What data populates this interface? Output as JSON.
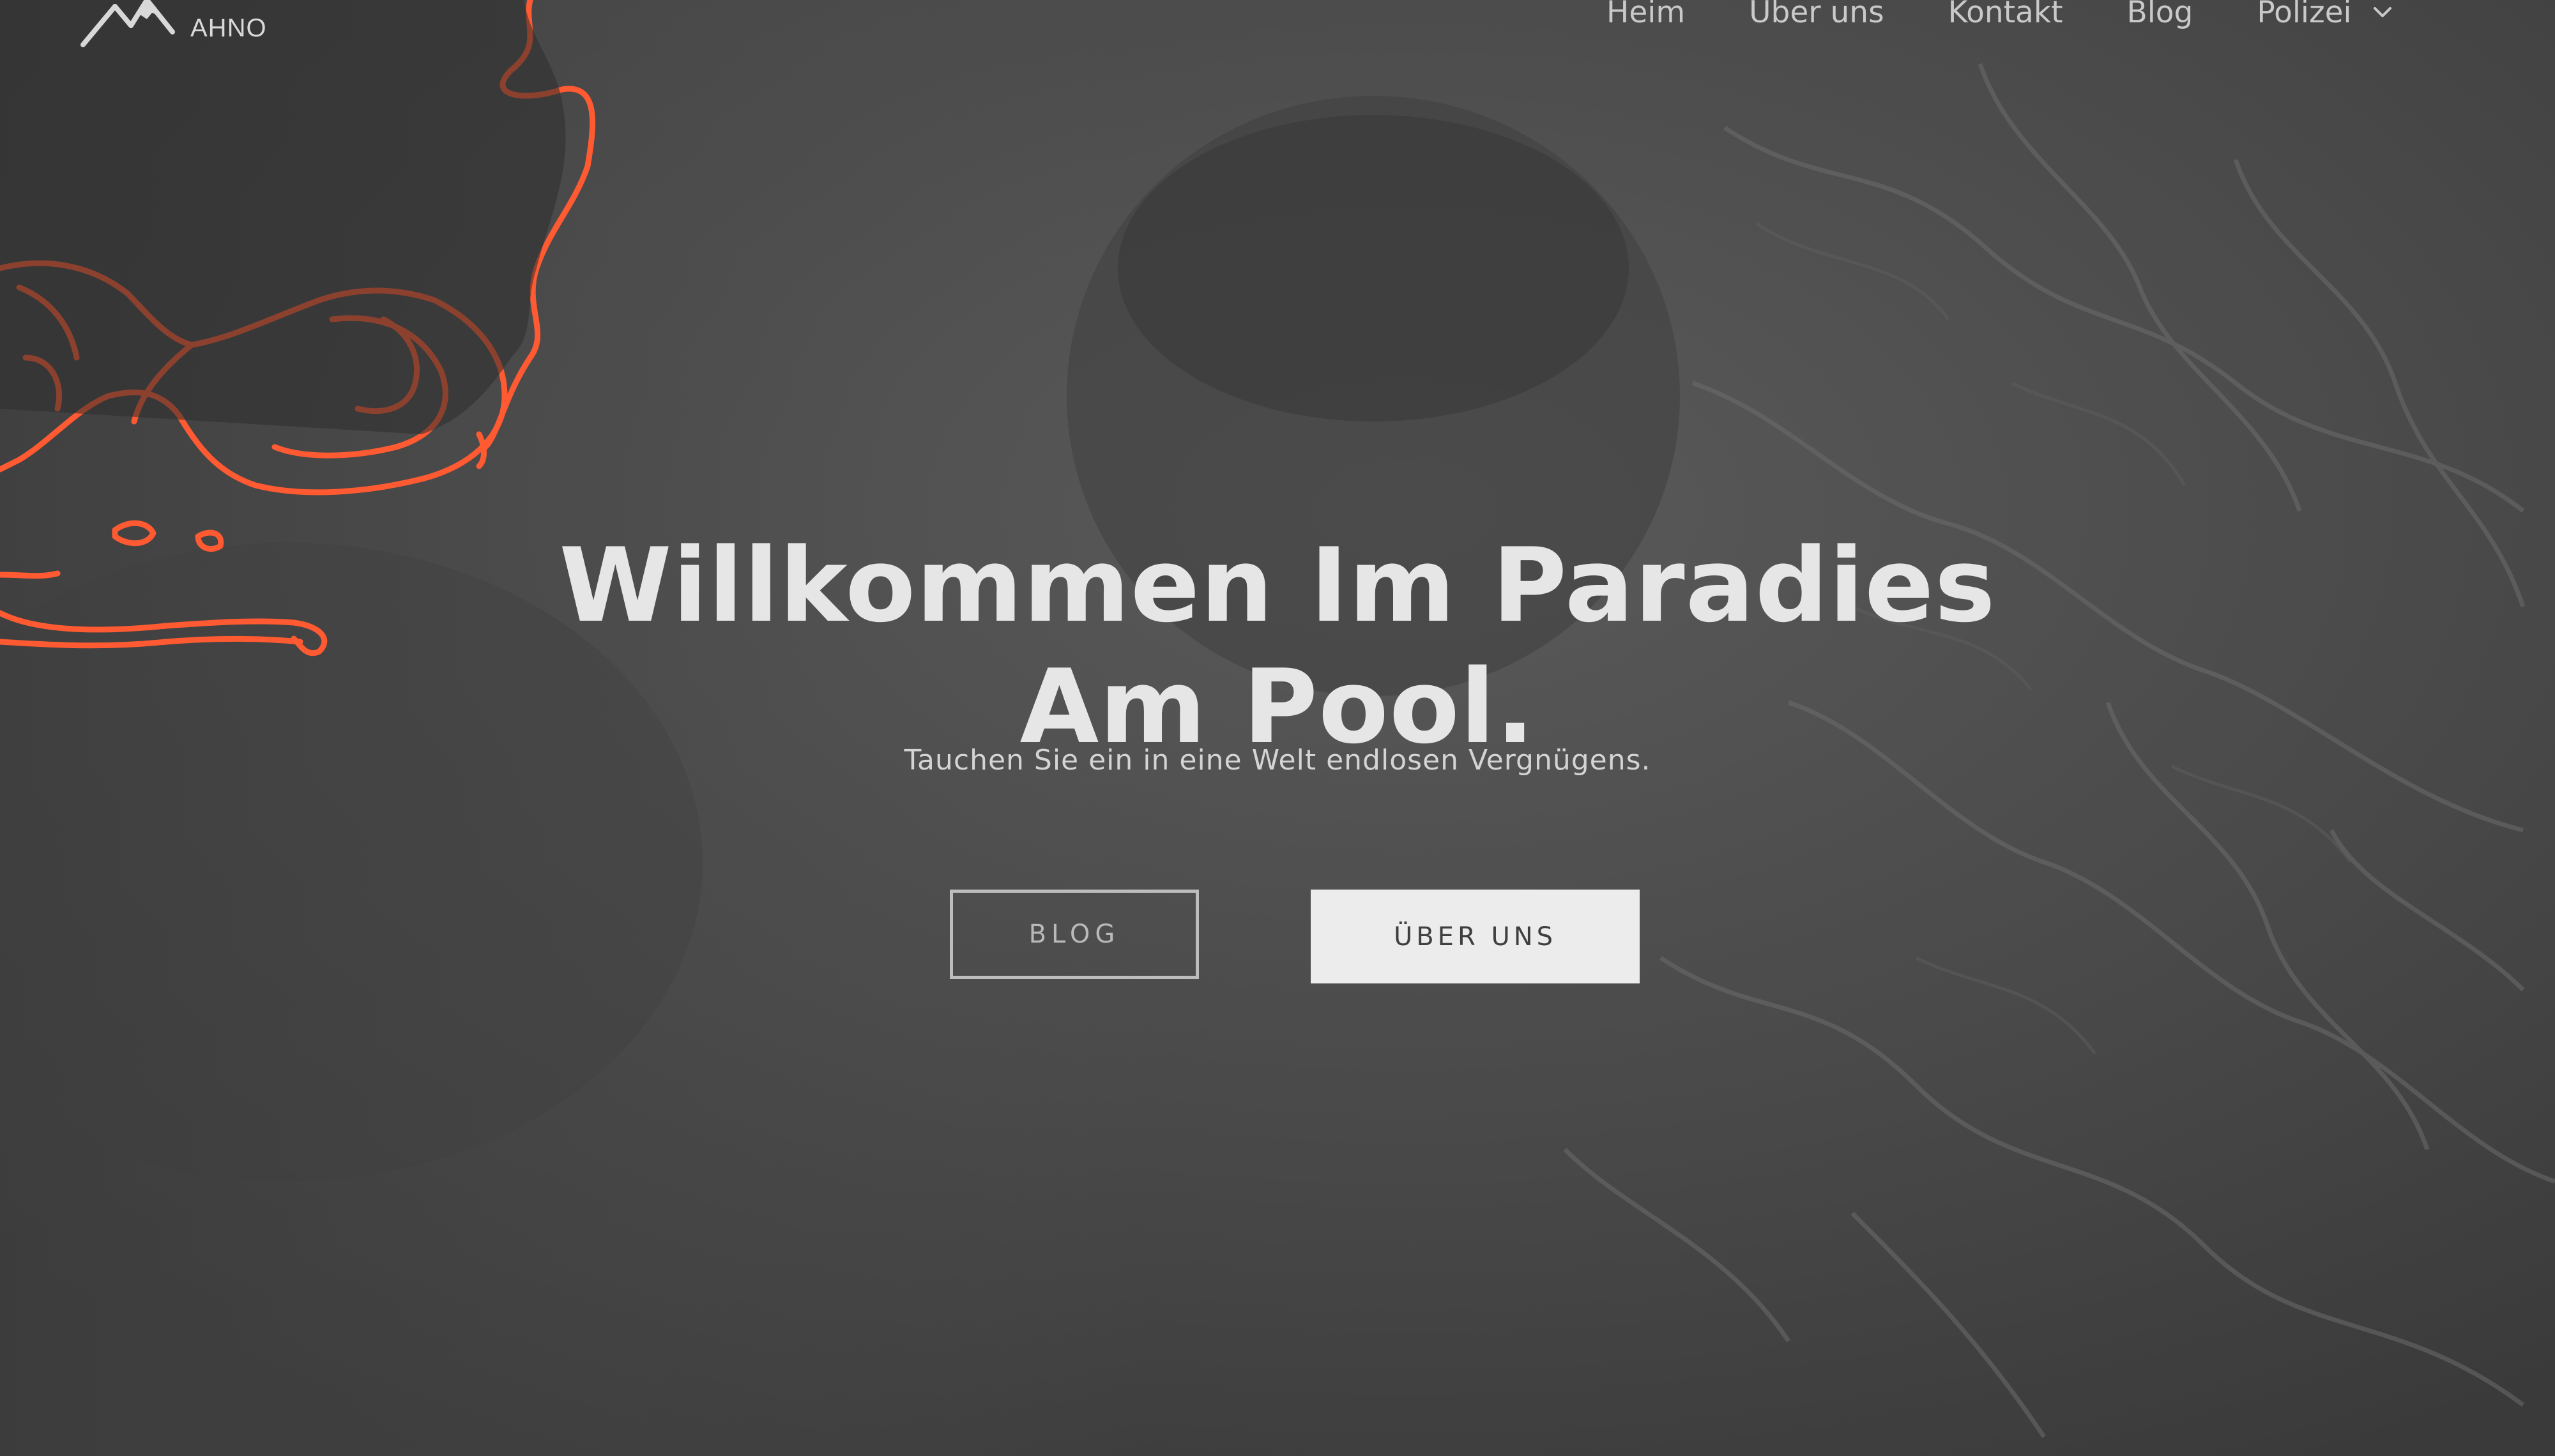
{
  "brand": {
    "logo_text": "AHNO"
  },
  "nav": {
    "items": [
      {
        "label": "Heim"
      },
      {
        "label": "Über uns"
      },
      {
        "label": "Kontakt"
      },
      {
        "label": "Blog"
      },
      {
        "label": "Polizei",
        "has_dropdown": true
      }
    ]
  },
  "hero": {
    "title_line1": "Willkommen Im Paradies",
    "title_line2": "Am Pool.",
    "subtitle": "Tauchen Sie ein in eine Welt endlosen Vergnügens.",
    "btn_primary": "BLOG",
    "btn_secondary": "ÜBER UNS"
  },
  "colors": {
    "overlay": "#4a4a4a",
    "accent_outline": "#ff5a32",
    "text_light": "#e6e6e6"
  }
}
